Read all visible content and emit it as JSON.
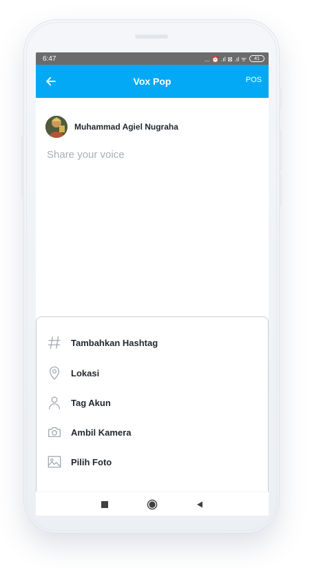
{
  "status_bar": {
    "time": "6:47",
    "icons_text": "... ⏰ .ıl ⊠ .ıl ᯤ",
    "battery": "41"
  },
  "app_bar": {
    "title": "Vox Pop",
    "post_label": "POS",
    "back_icon": "arrow-left-icon",
    "background": "#03a9f4"
  },
  "composer": {
    "author_name": "Muhammad Agiel Nugraha",
    "placeholder": "Share your voice",
    "value": ""
  },
  "sheet": {
    "items": [
      {
        "label": "Tambahkan Hashtag",
        "icon": "hashtag-icon"
      },
      {
        "label": "Lokasi",
        "icon": "location-pin-icon"
      },
      {
        "label": "Tag Akun",
        "icon": "user-icon"
      },
      {
        "label": "Ambil Kamera",
        "icon": "camera-icon"
      },
      {
        "label": "Pilih Foto",
        "icon": "image-icon"
      }
    ]
  },
  "nav_bar": {
    "buttons": [
      "recents-square-icon",
      "home-circle-icon",
      "back-triangle-icon"
    ]
  }
}
